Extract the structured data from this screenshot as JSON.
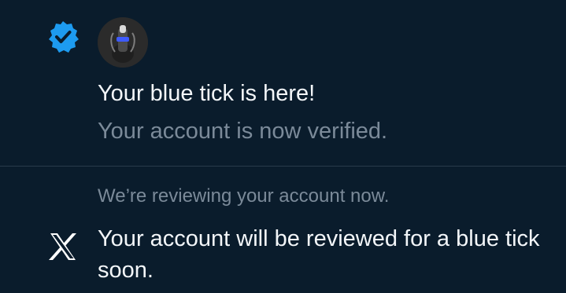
{
  "notification_verified": {
    "icon": "verified-badge-icon",
    "avatar": "user-avatar",
    "title": "Your blue tick is here!",
    "subtitle": "Your account is now verified."
  },
  "notification_review": {
    "status": "We’re reviewing your account now.",
    "icon": "x-logo-icon",
    "message": "Your account will be reviewed for a blue tick soon."
  },
  "colors": {
    "background": "#0a1c2c",
    "primary_text": "#f3f6f9",
    "secondary_text": "#7b8a99",
    "verified_blue": "#1d9bf0",
    "divider": "#2a3b4c"
  }
}
